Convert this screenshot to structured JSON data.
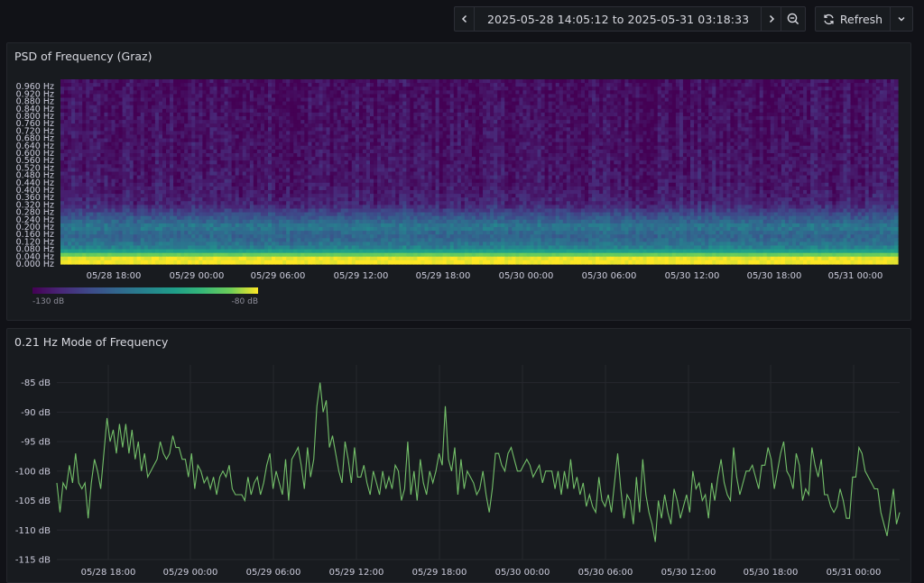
{
  "toolbar": {
    "time_range": "2025-05-28 14:05:12 to 2025-05-31 03:18:33",
    "refresh_label": "Refresh",
    "icons": [
      "chevron-left-icon",
      "clock-icon",
      "chevron-down-icon",
      "chevron-right-icon",
      "zoom-out-icon",
      "refresh-icon",
      "chevron-down-icon"
    ]
  },
  "panels": {
    "heatmap": {
      "title": "PSD of Frequency (Graz)",
      "legend_min": "-130 dB",
      "legend_max": "-80 dB"
    },
    "line": {
      "title": "0.21 Hz Mode of Frequency"
    }
  },
  "colors": {
    "background": "#111217",
    "panel": "#181b1f",
    "line_series": "#73bf69",
    "gridline": "#2a2c32"
  },
  "chart_data": [
    {
      "type": "heatmap",
      "title": "PSD of Frequency (Graz)",
      "y_ticks": [
        "0.000 Hz",
        "0.040 Hz",
        "0.080 Hz",
        "0.120 Hz",
        "0.160 Hz",
        "0.200 Hz",
        "0.240 Hz",
        "0.280 Hz",
        "0.320 Hz",
        "0.360 Hz",
        "0.400 Hz",
        "0.440 Hz",
        "0.480 Hz",
        "0.520 Hz",
        "0.560 Hz",
        "0.600 Hz",
        "0.640 Hz",
        "0.680 Hz",
        "0.720 Hz",
        "0.760 Hz",
        "0.800 Hz",
        "0.840 Hz",
        "0.880 Hz",
        "0.920 Hz",
        "0.960 Hz"
      ],
      "x_ticks": [
        "05/28 18:00",
        "05/29 00:00",
        "05/29 06:00",
        "05/29 12:00",
        "05/29 18:00",
        "05/30 00:00",
        "05/30 06:00",
        "05/30 12:00",
        "05/30 18:00",
        "05/31 00:00"
      ],
      "ylim": [
        0,
        1.0
      ],
      "color_scale": [
        "-130 dB",
        "-80 dB"
      ],
      "colormap": "viridis",
      "frequency_profile_db": [
        {
          "freq": 0.0,
          "db": -80
        },
        {
          "freq": 0.04,
          "db": -81
        },
        {
          "freq": 0.08,
          "db": -104
        },
        {
          "freq": 0.12,
          "db": -110
        },
        {
          "freq": 0.16,
          "db": -112
        },
        {
          "freq": 0.2,
          "db": -107
        },
        {
          "freq": 0.24,
          "db": -113
        },
        {
          "freq": 0.28,
          "db": -118
        },
        {
          "freq": 0.32,
          "db": -124
        },
        {
          "freq": 0.4,
          "db": -126
        },
        {
          "freq": 0.6,
          "db": -127
        },
        {
          "freq": 0.96,
          "db": -128
        }
      ]
    },
    {
      "type": "line",
      "title": "0.21 Hz Mode of Frequency",
      "x_ticks": [
        "05/28 18:00",
        "05/29 00:00",
        "05/29 06:00",
        "05/29 12:00",
        "05/29 18:00",
        "05/30 00:00",
        "05/30 06:00",
        "05/30 12:00",
        "05/30 18:00",
        "05/31 00:00"
      ],
      "y_ticks": [
        "-85 dB",
        "-90 dB",
        "-95 dB",
        "-100 dB",
        "-105 dB",
        "-110 dB",
        "-115 dB"
      ],
      "ylim": [
        -115,
        -82
      ],
      "series": [
        {
          "values": [
            -102,
            -107,
            -102,
            -103,
            -99,
            -102,
            -97,
            -102,
            -103,
            -102,
            -108,
            -102,
            -98,
            -100,
            -103,
            -97,
            -91,
            -95,
            -93,
            -97,
            -92,
            -96,
            -92,
            -97,
            -93,
            -98,
            -95,
            -100,
            -97,
            -101,
            -100,
            -99,
            -98,
            -95,
            -97,
            -98,
            -97,
            -94,
            -96,
            -96,
            -98,
            -98,
            -101,
            -97,
            -103,
            -99,
            -100,
            -102,
            -101,
            -103,
            -101,
            -104,
            -101,
            -100,
            -101,
            -99,
            -103,
            -104,
            -104,
            -104,
            -105,
            -101,
            -104,
            -102,
            -101,
            -104,
            -102,
            -99,
            -97,
            -103,
            -100,
            -102,
            -104,
            -98,
            -105,
            -98,
            -97,
            -96,
            -99,
            -103,
            -96,
            -101,
            -98,
            -89,
            -85,
            -90,
            -88,
            -96,
            -94,
            -97,
            -100,
            -102,
            -95,
            -98,
            -102,
            -96,
            -101,
            -101,
            -99,
            -102,
            -104,
            -100,
            -102,
            -104,
            -100,
            -103,
            -101,
            -103,
            -99,
            -100,
            -105,
            -103,
            -95,
            -104,
            -100,
            -105,
            -98,
            -102,
            -104,
            -100,
            -102,
            -100,
            -97,
            -99,
            -89,
            -98,
            -100,
            -96,
            -104,
            -98,
            -103,
            -100,
            -101,
            -102,
            -104,
            -103,
            -100,
            -104,
            -107,
            -103,
            -97,
            -97,
            -99,
            -100,
            -97,
            -96,
            -98,
            -100,
            -100,
            -99,
            -98,
            -99,
            -101,
            -100,
            -99,
            -102,
            -100,
            -100,
            -100,
            -103,
            -100,
            -104,
            -100,
            -103,
            -98,
            -103,
            -101,
            -104,
            -102,
            -106,
            -104,
            -106,
            -107,
            -101,
            -105,
            -106,
            -104,
            -107,
            -102,
            -97,
            -103,
            -108,
            -104,
            -105,
            -109,
            -101,
            -107,
            -98,
            -104,
            -107,
            -109,
            -112,
            -105,
            -108,
            -104,
            -107,
            -109,
            -103,
            -105,
            -108,
            -106,
            -104,
            -107,
            -100,
            -103,
            -102,
            -105,
            -104,
            -108,
            -102,
            -105,
            -101,
            -98,
            -102,
            -104,
            -105,
            -96,
            -101,
            -104,
            -102,
            -100,
            -100,
            -99,
            -101,
            -103,
            -99,
            -99,
            -96,
            -98,
            -103,
            -100,
            -97,
            -95,
            -100,
            -101,
            -103,
            -97,
            -99,
            -105,
            -103,
            -104,
            -96,
            -99,
            -101,
            -98,
            -104,
            -104,
            -106,
            -107,
            -106,
            -103,
            -105,
            -108,
            -108,
            -101,
            -101,
            -96,
            -97,
            -100,
            -101,
            -102,
            -103,
            -103,
            -107,
            -109,
            -111,
            -107,
            -103,
            -109,
            -107
          ]
        }
      ]
    }
  ]
}
